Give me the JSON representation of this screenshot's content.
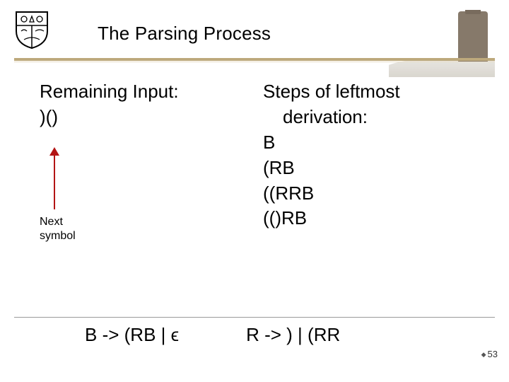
{
  "header": {
    "title": "The Parsing Process"
  },
  "left": {
    "remaining_label": "Remaining Input:",
    "remaining_value": ")()",
    "next_symbol_l1": "Next",
    "next_symbol_l2": "symbol"
  },
  "right": {
    "steps_label_l1": "Steps of leftmost",
    "steps_label_l2": "derivation:",
    "deriv": [
      "B",
      "(RB",
      "((RRB",
      "(()RB"
    ]
  },
  "grammar": {
    "rule_b": "B -> (RB | ϵ",
    "rule_r": "R -> ) | (RR"
  },
  "page": {
    "number": "53"
  }
}
